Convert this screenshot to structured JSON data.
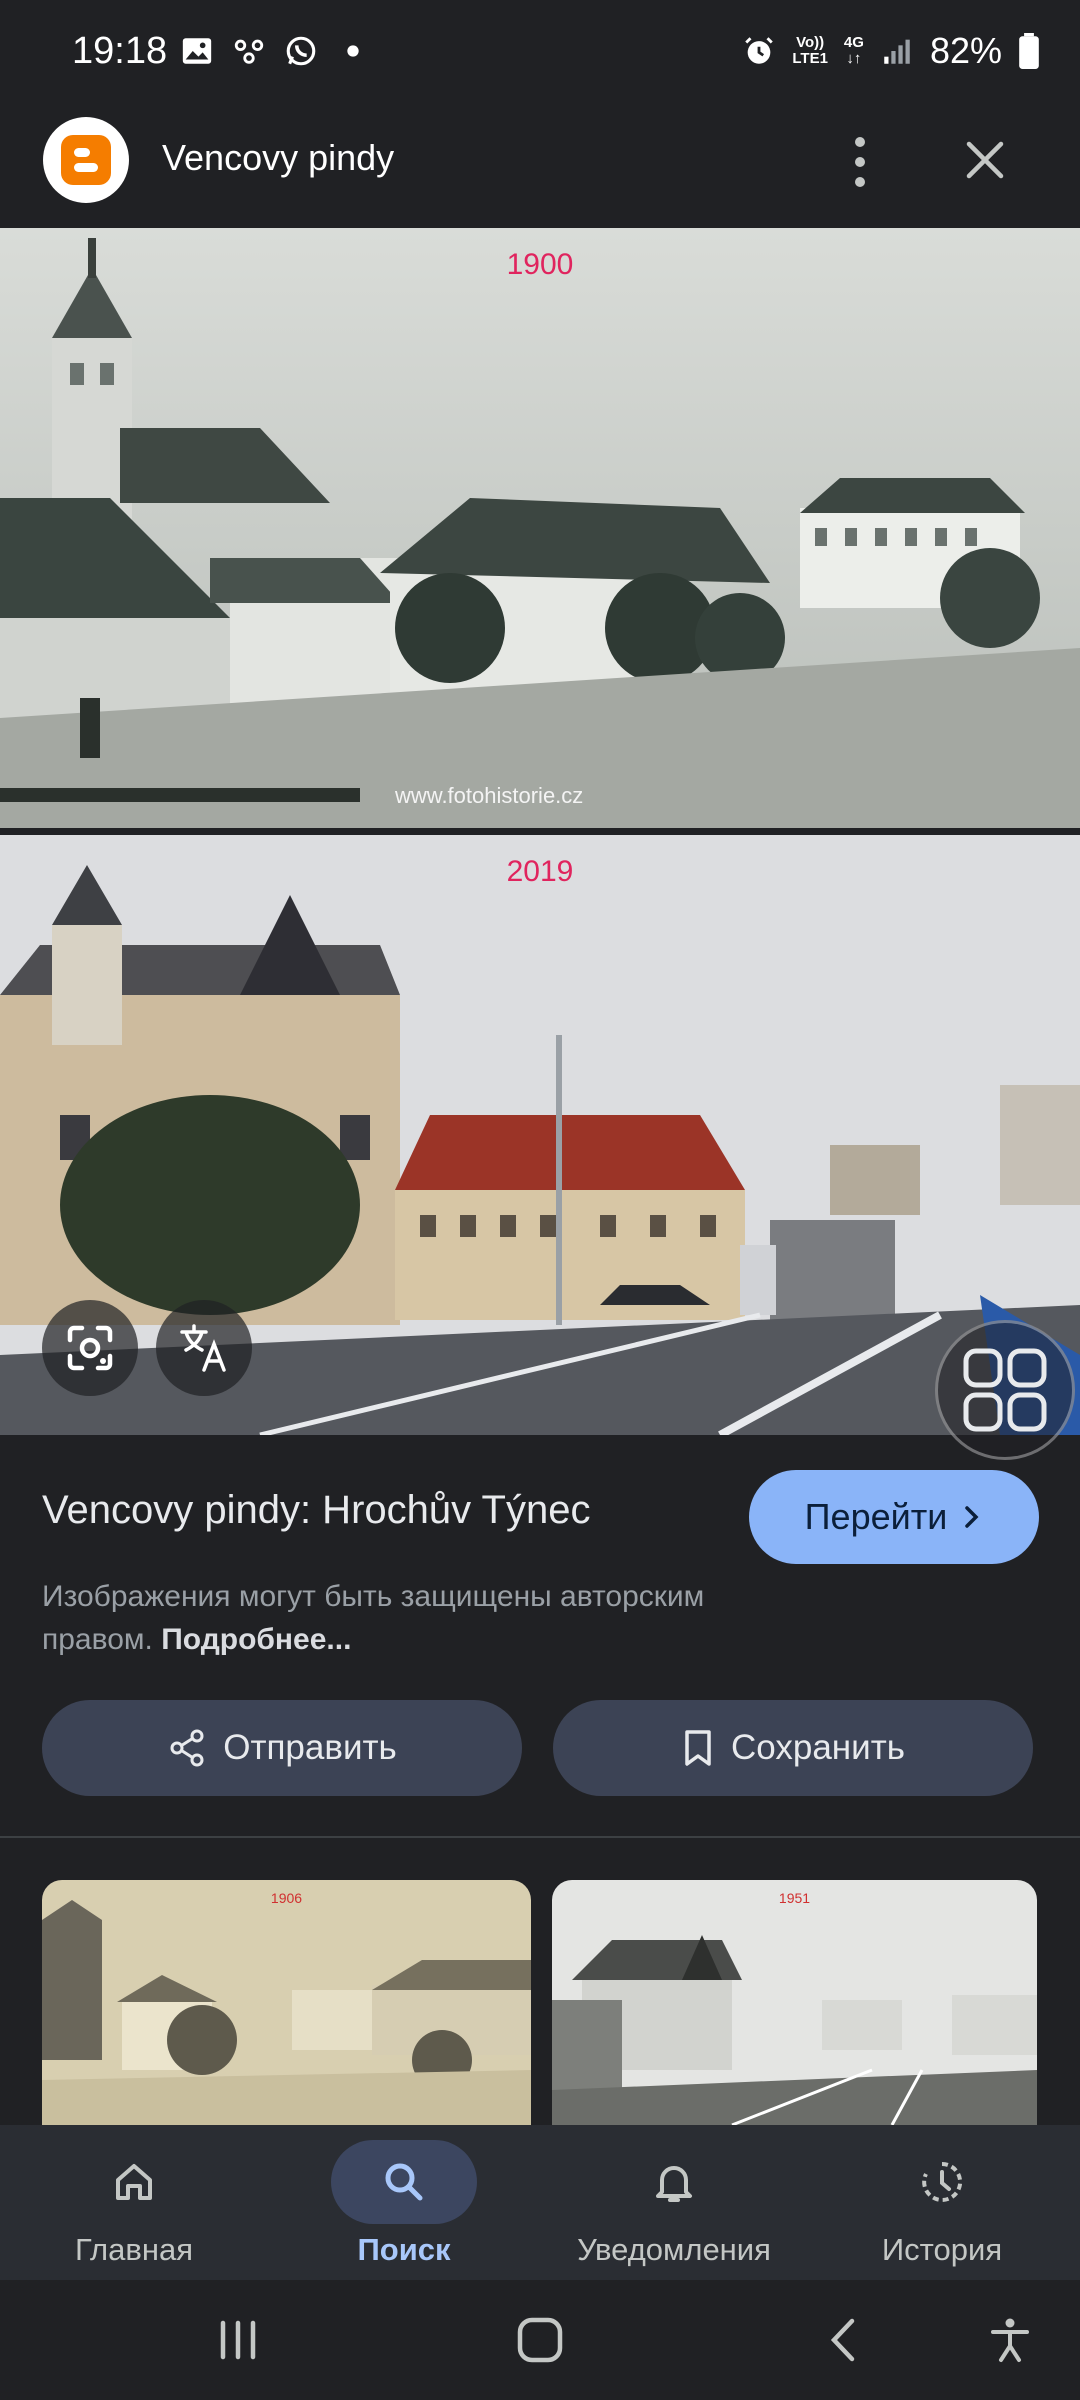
{
  "status_bar": {
    "time": "19:18",
    "network_top": "Vo))",
    "network_bottom": "LTE1",
    "gen_top": "4G",
    "gen_bottom": "↓↑",
    "battery": "82%"
  },
  "header": {
    "title": "Vencovy pindy"
  },
  "images": {
    "top_year": "1900",
    "top_watermark": "www.fotohistorie.cz",
    "bottom_year": "2019"
  },
  "result": {
    "title": "Vencovy pindy: Hrochův Týnec",
    "visit_label": "Перейти",
    "copyright_text": "Изображения могут быть защищены авторским правом.",
    "learn_more": "Подробнее..."
  },
  "actions": {
    "share_label": "Отправить",
    "save_label": "Сохранить"
  },
  "related": [
    {
      "year": "1906"
    },
    {
      "year": "1951"
    }
  ],
  "bottom_nav": {
    "items": [
      {
        "label": "Главная",
        "icon": "home-icon",
        "active": false
      },
      {
        "label": "Поиск",
        "icon": "search-icon",
        "active": true
      },
      {
        "label": "Уведомления",
        "icon": "bell-icon",
        "active": false
      },
      {
        "label": "История",
        "icon": "history-icon",
        "active": false
      }
    ]
  },
  "colors": {
    "background": "#202124",
    "accent": "#8ab4f8",
    "year_label": "#e0245e",
    "button_bg": "#3c4355"
  }
}
